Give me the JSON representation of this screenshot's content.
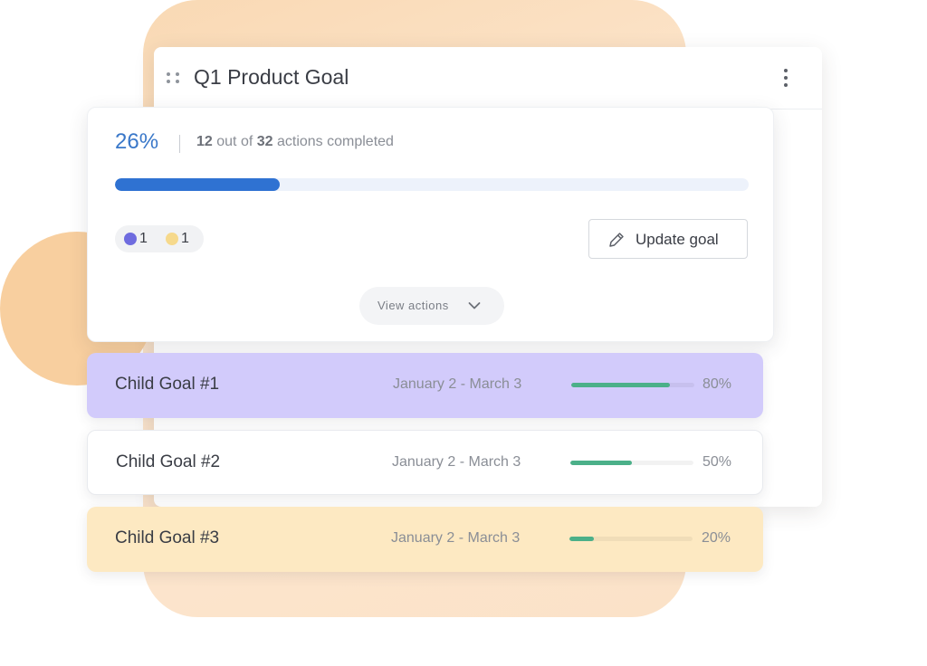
{
  "colors": {
    "accent": "#2f72d2",
    "percent_text": "#3a78c9",
    "child_progress": "#4bb089",
    "chip_purple": "#6f6cdf",
    "chip_yellow": "#f6d98c",
    "row_purple": "#d2cbfb",
    "row_yellow": "#fde9c2",
    "row_white": "#ffffff"
  },
  "goal": {
    "title": "Q1 Product Goal",
    "drag_handle_icon": "drag-handle-icon",
    "menu_icon": "kebab-menu-icon"
  },
  "progress": {
    "percent": "26%",
    "fraction": 0.26,
    "completed": "12",
    "text_out_of": "out of",
    "total": "32",
    "text_actions": "actions completed"
  },
  "status_chips": [
    {
      "color": "#6f6cdf",
      "count": "1"
    },
    {
      "color": "#f6d98c",
      "count": "1"
    }
  ],
  "buttons": {
    "update_goal": "Update goal",
    "update_goal_icon": "pencil-icon",
    "view_actions": "View actions",
    "view_actions_icon": "chevron-down-icon"
  },
  "child_goals": [
    {
      "name": "Child Goal #1",
      "dates": "January 2 - March 3",
      "percent": "80%",
      "fraction": 0.8,
      "bg": "#d2cbfb"
    },
    {
      "name": "Child Goal #2",
      "dates": "January 2 - March 3",
      "percent": "50%",
      "fraction": 0.5,
      "bg": "#ffffff"
    },
    {
      "name": "Child Goal #3",
      "dates": "January 2 - March 3",
      "percent": "20%",
      "fraction": 0.2,
      "bg": "#fde9c2"
    }
  ]
}
